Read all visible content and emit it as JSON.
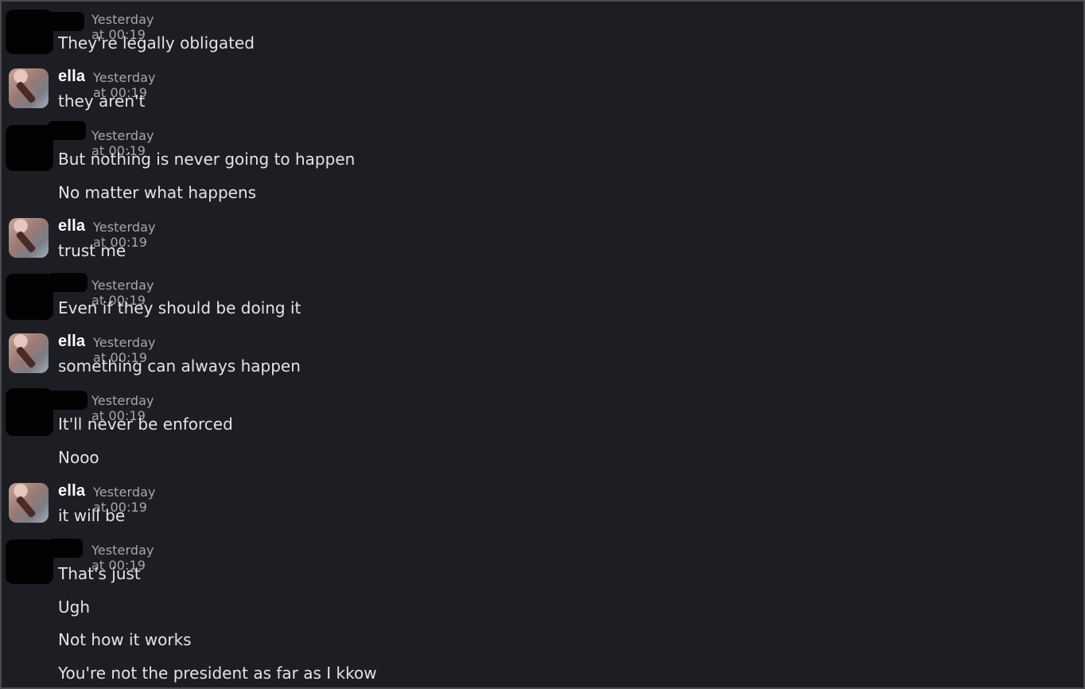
{
  "messages": [
    {
      "author": "",
      "redacted": true,
      "time": "Yesterday at 00:19",
      "lines": [
        "They're legally obligated"
      ]
    },
    {
      "author": "ella",
      "redacted": false,
      "time": "Yesterday at 00:19",
      "lines": [
        "they aren't"
      ]
    },
    {
      "author": "",
      "redacted": true,
      "time": "Yesterday at 00:19",
      "lines": [
        "But nothing is never going to happen",
        "No matter what happens"
      ]
    },
    {
      "author": "ella",
      "redacted": false,
      "time": "Yesterday at 00:19",
      "lines": [
        "trust me"
      ]
    },
    {
      "author": "",
      "redacted": true,
      "time": "Yesterday at 00:19",
      "lines": [
        "Even if they should be doing it"
      ]
    },
    {
      "author": "ella",
      "redacted": false,
      "time": "Yesterday at 00:19",
      "lines": [
        "something can always happen"
      ]
    },
    {
      "author": "",
      "redacted": true,
      "time": "Yesterday at 00:19",
      "lines": [
        "It'll never be enforced",
        "Nooo"
      ]
    },
    {
      "author": "ella",
      "redacted": false,
      "time": "Yesterday at 00:19",
      "lines": [
        "it will be"
      ]
    },
    {
      "author": "",
      "redacted": true,
      "time": "Yesterday at 00:19",
      "lines": [
        "That's just",
        "Ugh",
        "Not how it works",
        "You're not the president as far as I kkow"
      ]
    }
  ]
}
